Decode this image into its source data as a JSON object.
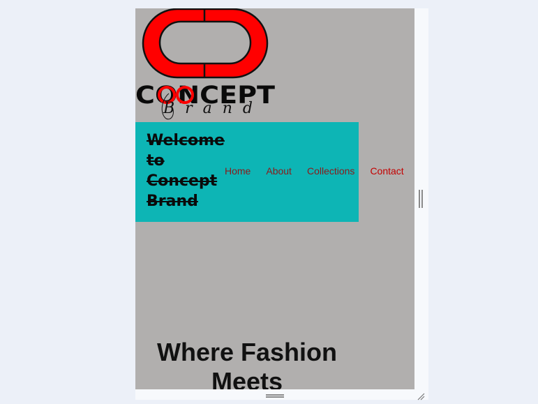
{
  "brand": {
    "logo_word": "CONCEPT",
    "logo_script": "Brand",
    "colors": {
      "logo_red": "#ff0000",
      "logo_outline": "#111111"
    }
  },
  "hero": {
    "welcome_text": "Welcome to Concept Brand",
    "background_color": "#0db5b5"
  },
  "nav": {
    "items": [
      {
        "label": "Home"
      },
      {
        "label": "About"
      },
      {
        "label": "Collections"
      },
      {
        "label": "Contact"
      }
    ],
    "link_color": "#8b1a1a",
    "active_color": "#c40000"
  },
  "main": {
    "tagline": "Where Fashion Meets",
    "background_color": "#b1afae"
  },
  "icons": [
    "vertical-resize-handle-icon",
    "horizontal-resize-handle-icon",
    "corner-resize-grip-icon"
  ]
}
